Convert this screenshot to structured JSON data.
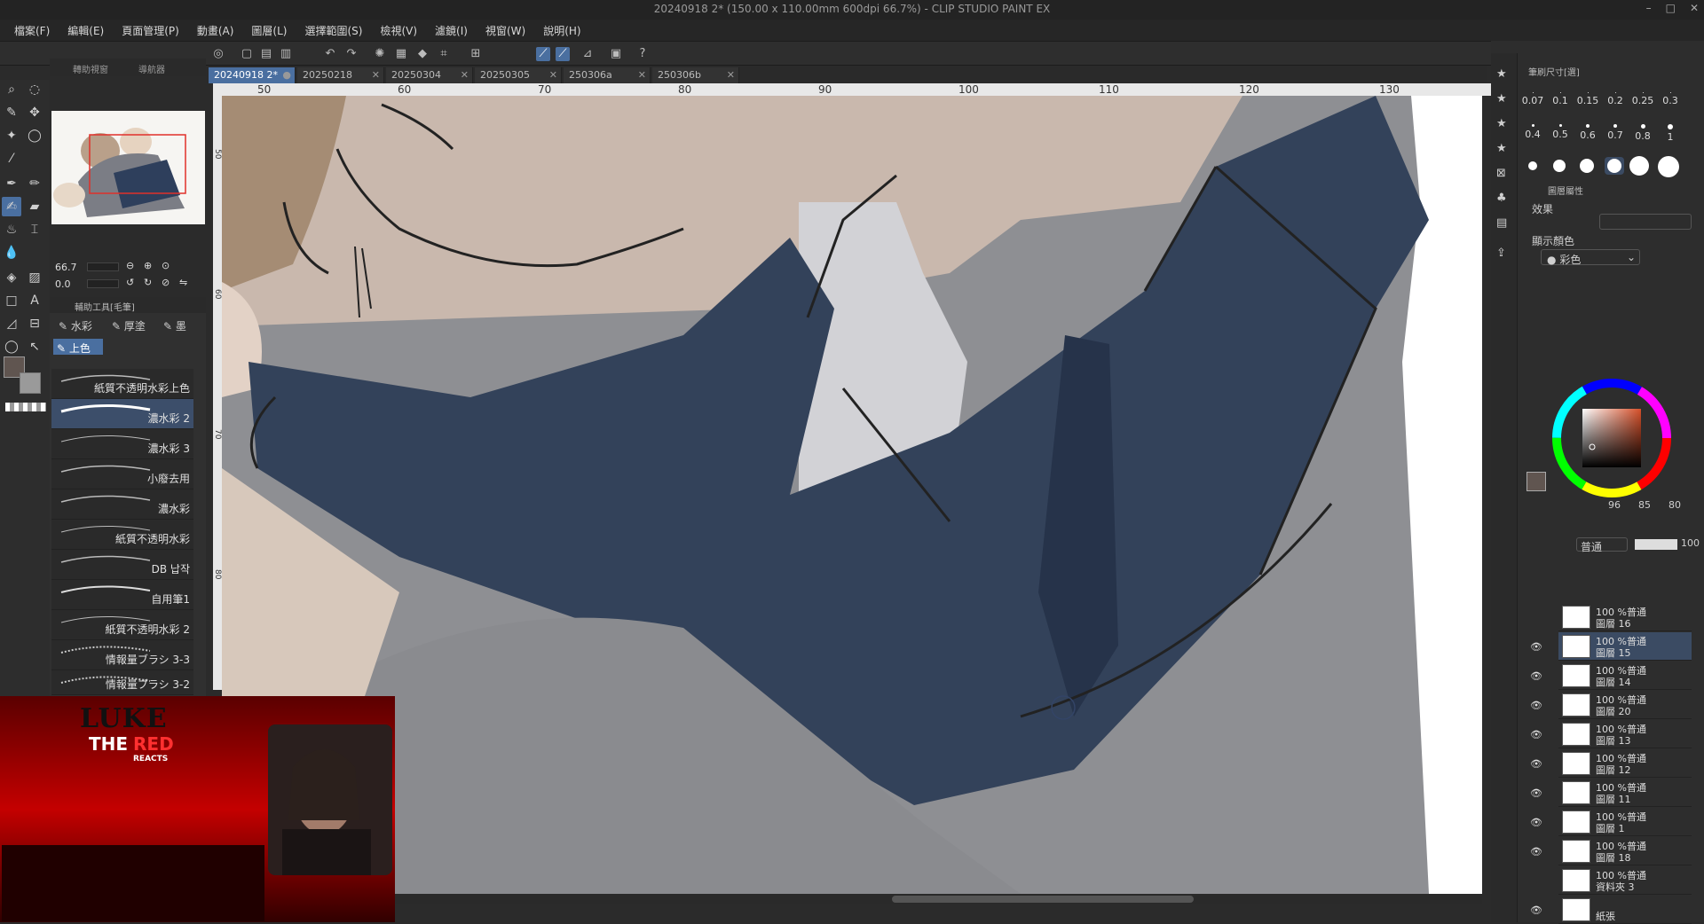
{
  "window": {
    "title": "20240918 2* (150.00 x 110.00mm 600dpi 66.7%) - CLIP STUDIO PAINT EX",
    "controls": [
      "–",
      "□",
      "✕"
    ]
  },
  "menu": [
    "檔案(F)",
    "編輯(E)",
    "頁面管理(P)",
    "動畫(A)",
    "圖層(L)",
    "選擇範圍(S)",
    "檢視(V)",
    "濾鏡(I)",
    "視窗(W)",
    "說明(H)"
  ],
  "navigator": {
    "tabs": [
      "轉助視窗",
      "導航器"
    ],
    "zoom": "66.7",
    "rotation": "0.0"
  },
  "subtool": {
    "header": "輔助工具[毛筆]",
    "groups": [
      "水彩",
      "厚塗",
      "墨",
      "上色"
    ],
    "selected_group": "上色",
    "brushes": [
      "紙質不透明水彩上色",
      "濃水彩 2",
      "濃水彩 3",
      "小廢去用",
      "濃水彩",
      "紙質不透明水彩",
      "DB 납작",
      "自用筆1",
      "紙質不透明水彩 2",
      "情報量ブラシ 3-3",
      "情報量ブラシ 3-2"
    ],
    "selected_brush": "濃水彩 2"
  },
  "canvas_tabs": [
    {
      "label": "20240918 2*",
      "active": true
    },
    {
      "label": "20250218",
      "active": false
    },
    {
      "label": "20250304",
      "active": false
    },
    {
      "label": "20250305",
      "active": false
    },
    {
      "label": "250306a",
      "active": false
    },
    {
      "label": "250306b",
      "active": false
    }
  ],
  "ruler": {
    "top_marks": [
      "50",
      "60",
      "70",
      "80",
      "90",
      "100",
      "110",
      "120",
      "130"
    ],
    "left_marks": [
      "50",
      "60",
      "70",
      "80"
    ]
  },
  "stream_overlay": {
    "line1": "LUKE",
    "line2": "THE",
    "line3": "RED",
    "line4": "REACTS"
  },
  "brush_size_panel": {
    "title": "筆刷尺寸[選]",
    "sizes_row1": [
      "0.07",
      "0.1",
      "0.15",
      "0.2",
      "0.25",
      "0.3"
    ],
    "sizes_row2": [
      "0.4",
      "0.5",
      "0.6",
      "0.7",
      "0.8",
      "1"
    ]
  },
  "layer_property": {
    "title": "圖層屬性",
    "effect_label": "效果",
    "display_color_label": "顯示顏色",
    "display_color_value": "彩色"
  },
  "color": {
    "r": "96",
    "g": "85",
    "b": "80",
    "main_hex": "#605550"
  },
  "layers_panel": {
    "blend_mode": "普通",
    "opacity": "100",
    "layers": [
      {
        "pct": "100 %普通",
        "name": "圖層 16",
        "selected": false,
        "visible": false
      },
      {
        "pct": "100 %普通",
        "name": "圖層 15",
        "selected": true,
        "visible": true
      },
      {
        "pct": "100 %普通",
        "name": "圖層 14",
        "selected": false,
        "visible": true
      },
      {
        "pct": "100 %普通",
        "name": "圖層 20",
        "selected": false,
        "visible": true
      },
      {
        "pct": "100 %普通",
        "name": "圖層 13",
        "selected": false,
        "visible": true
      },
      {
        "pct": "100 %普通",
        "name": "圖層 12",
        "selected": false,
        "visible": true
      },
      {
        "pct": "100 %普通",
        "name": "圖層 11",
        "selected": false,
        "visible": true
      },
      {
        "pct": "100 %普通",
        "name": "圖層 1",
        "selected": false,
        "visible": true
      },
      {
        "pct": "100 %普通",
        "name": "圖層 18",
        "selected": false,
        "visible": true
      },
      {
        "pct": "100 %普通",
        "name": "資料夾 3",
        "selected": false,
        "visible": false
      },
      {
        "pct": "",
        "name": "紙張",
        "selected": false,
        "visible": true
      }
    ]
  }
}
